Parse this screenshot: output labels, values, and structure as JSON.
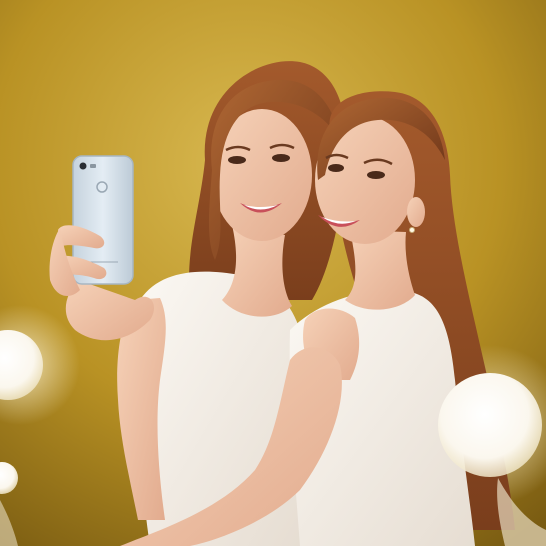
{
  "scene": {
    "description_free": true,
    "palette": {
      "background_light": "#d4b24a",
      "background_mid": "#b68f22",
      "background_dark": "#6e5410",
      "hair": "#8a4a22",
      "hair_highlight": "#b8683a",
      "skin": "#f0c8ac",
      "skin_shadow": "#d8a084",
      "dress": "#f7f3ee",
      "dress_shadow": "#e2d8cc",
      "lips": "#c8505a",
      "phone": "#d8e4ee",
      "phone_edge": "#b8c6d2",
      "bulb": "#ffffff"
    },
    "phone": {
      "icons": [
        "camera-lens-icon",
        "flash-icon",
        "fingerprint-sensor-icon"
      ]
    }
  }
}
